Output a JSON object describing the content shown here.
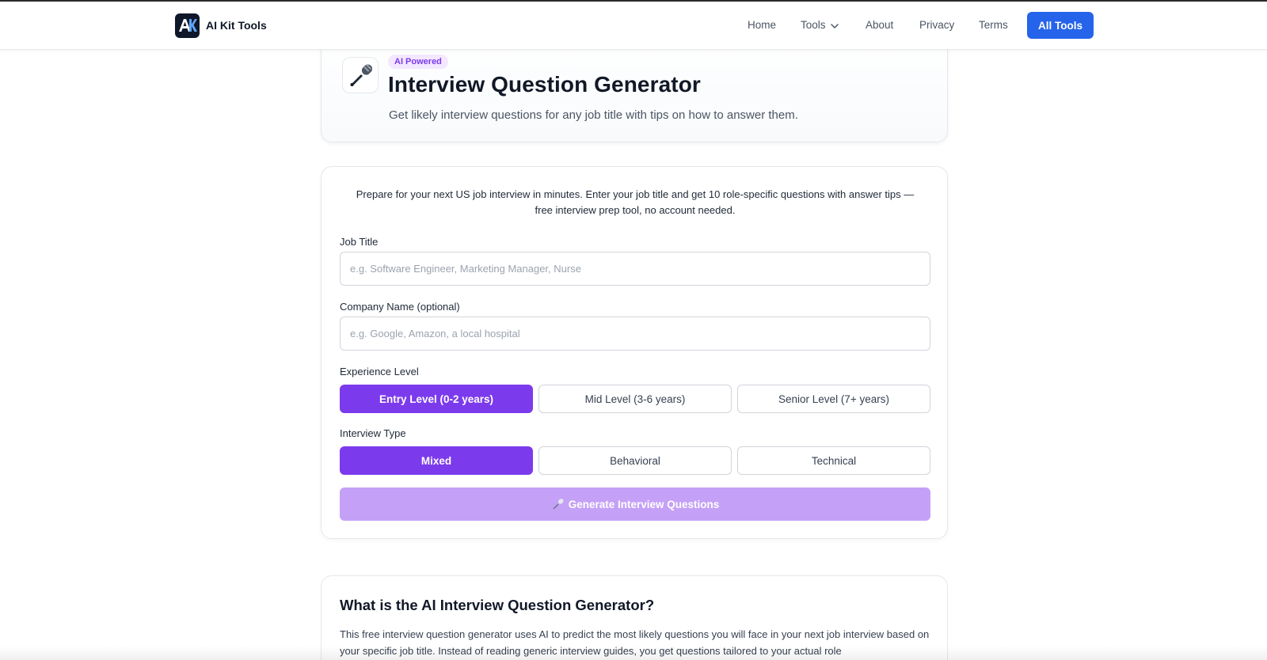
{
  "nav": {
    "brand_name": "AI Kit Tools",
    "brand_logo_text": "AK",
    "links": {
      "home": "Home",
      "tools": "Tools",
      "about": "About",
      "privacy": "Privacy",
      "terms": "Terms"
    },
    "all_tools_label": "All Tools"
  },
  "hero": {
    "badge": "AI Powered",
    "title": "Interview Question Generator",
    "subtitle": "Get likely interview questions for any job title with tips on how to answer them.",
    "icon": "microphone-icon"
  },
  "form": {
    "intro": "Prepare for your next US job interview in minutes. Enter your job title and get 10 role-specific questions with answer tips — free interview prep tool, no account needed.",
    "job_title": {
      "label": "Job Title",
      "value": "",
      "placeholder": "e.g. Software Engineer, Marketing Manager, Nurse"
    },
    "company": {
      "label": "Company Name (optional)",
      "value": "",
      "placeholder": "e.g. Google, Amazon, a local hospital"
    },
    "experience": {
      "label": "Experience Level",
      "options": [
        "Entry Level (0-2 years)",
        "Mid Level (3-6 years)",
        "Senior Level (7+ years)"
      ],
      "selected": "Entry Level (0-2 years)"
    },
    "interview_type": {
      "label": "Interview Type",
      "options": [
        "Mixed",
        "Behavioral",
        "Technical"
      ],
      "selected": "Mixed"
    },
    "generate_label": "Generate Interview Questions"
  },
  "info": {
    "title": "What is the AI Interview Question Generator?",
    "text": "This free interview question generator uses AI to predict the most likely questions you will face in your next job interview based on your specific job title. Instead of reading generic interview guides, you get questions tailored to your actual role"
  },
  "colors": {
    "primary_blue": "#2563eb",
    "accent_purple": "#7c3aed",
    "generate_disabled": "#c4a1f7",
    "badge_bg": "#f3e8ff"
  }
}
